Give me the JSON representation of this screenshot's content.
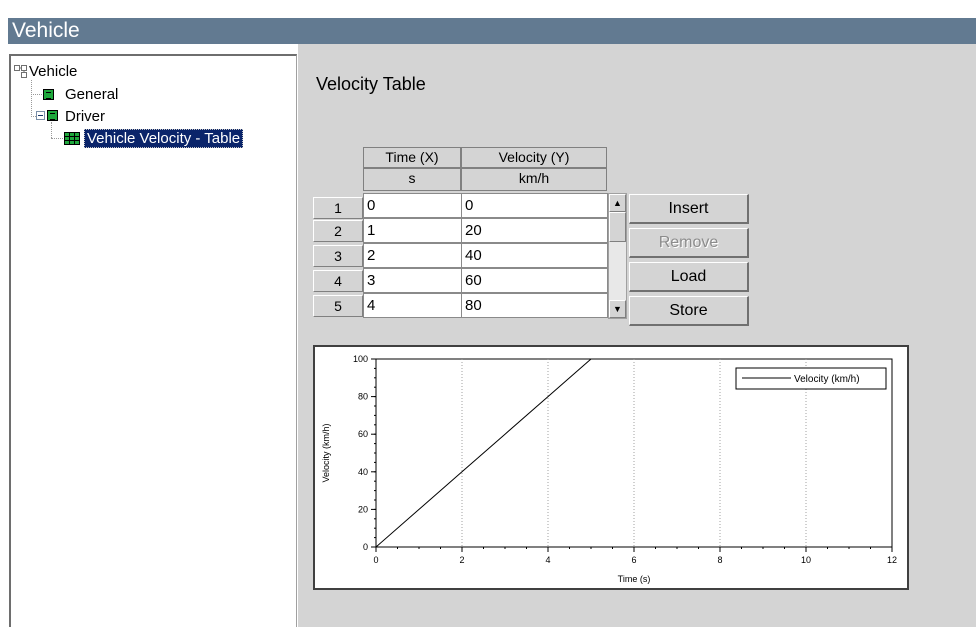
{
  "window": {
    "title": "Vehicle"
  },
  "tree": {
    "root": {
      "label": "Vehicle",
      "icon": "tree-root-icon"
    },
    "items": [
      {
        "label": "General",
        "icon": "green-grid-icon"
      },
      {
        "label": "Driver",
        "icon": "green-grid-icon",
        "expanded": true
      },
      {
        "label": "Vehicle Velocity - Table",
        "icon": "green-table-icon",
        "selected": true
      }
    ]
  },
  "panel": {
    "title": "Velocity Table",
    "table": {
      "columns": [
        {
          "name": "Time (X)",
          "unit": "s"
        },
        {
          "name": "Velocity (Y)",
          "unit": "km/h"
        }
      ],
      "rows": [
        {
          "index": "1",
          "x": "0",
          "y": "0"
        },
        {
          "index": "2",
          "x": "1",
          "y": "20"
        },
        {
          "index": "3",
          "x": "2",
          "y": "40"
        },
        {
          "index": "4",
          "x": "3",
          "y": "60"
        },
        {
          "index": "5",
          "x": "4",
          "y": "80"
        }
      ]
    },
    "buttons": {
      "insert": "Insert",
      "remove": "Remove",
      "load": "Load",
      "store": "Store"
    }
  },
  "chart_data": {
    "type": "line",
    "xlabel": "Time (s)",
    "ylabel": "Velocity (km/h)",
    "xlim": [
      0,
      12
    ],
    "ylim": [
      0,
      100
    ],
    "xticks": [
      "0",
      "2",
      "4",
      "6",
      "8",
      "10",
      "12"
    ],
    "yticks": [
      "0",
      "20",
      "40",
      "60",
      "80",
      "100"
    ],
    "grid": "vertical dotted",
    "legend_position": "top-right",
    "series": [
      {
        "name": "Velocity (km/h)",
        "x": [
          0,
          1,
          2,
          3,
          4,
          5
        ],
        "y": [
          0,
          20,
          40,
          60,
          80,
          100
        ],
        "color": "#000000"
      }
    ]
  }
}
